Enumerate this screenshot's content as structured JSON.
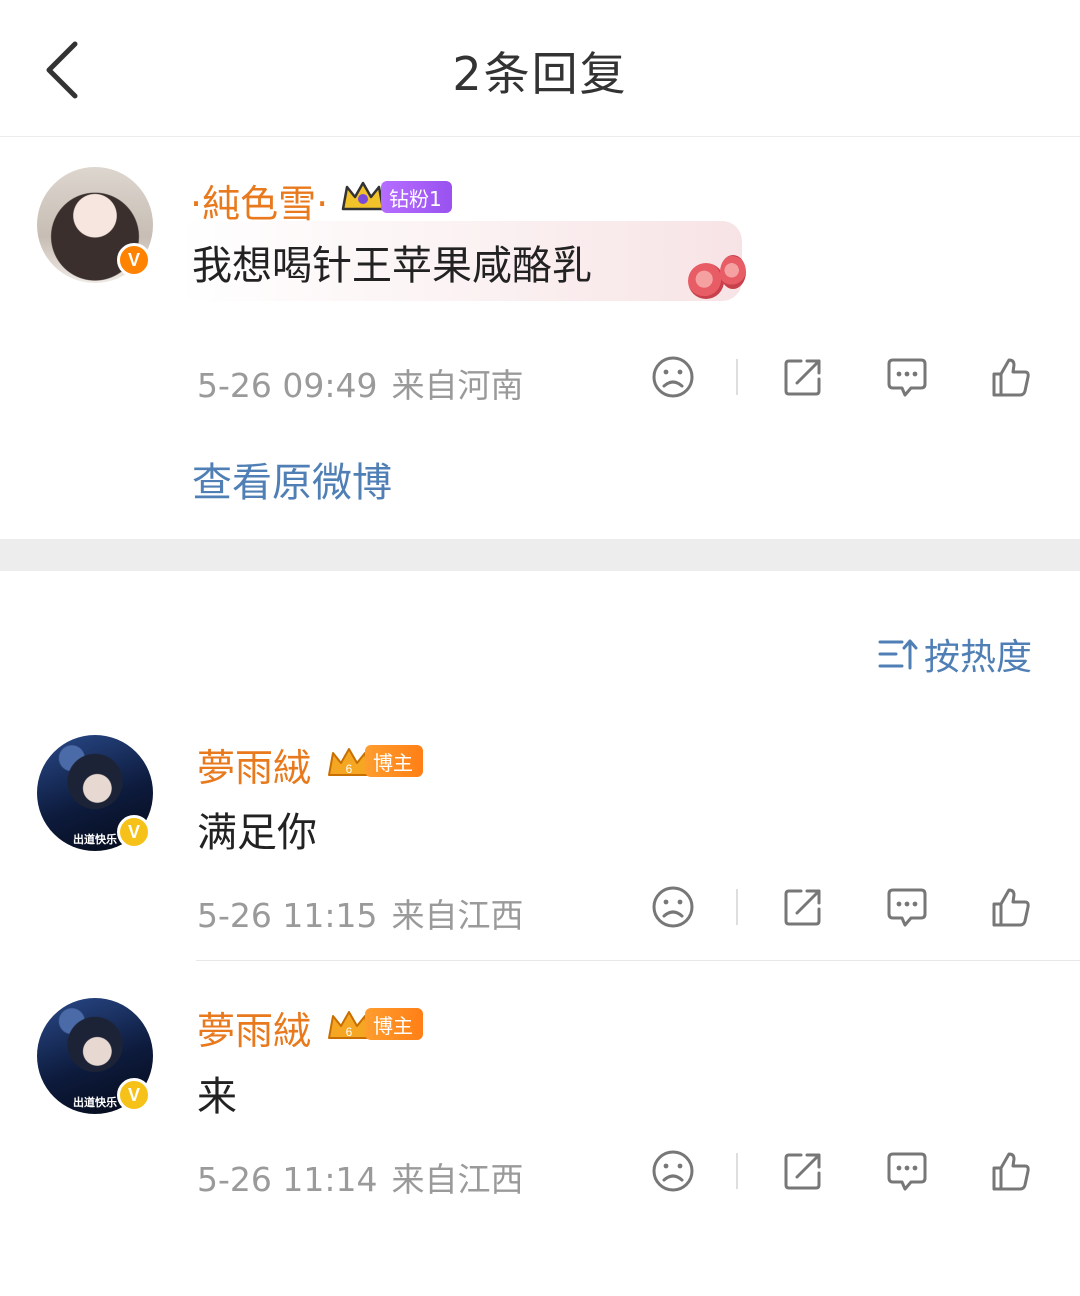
{
  "header": {
    "title": "2条回复",
    "back_icon": "chevron-left-icon"
  },
  "root_comment": {
    "username": "·純色雪·",
    "crown_icon": "crown-icon",
    "fan_badge": "钻粉1",
    "text": "我想喝针王苹果咸酪乳",
    "time": "5-26 09:49",
    "location": "来自河南",
    "view_original": "查看原微博"
  },
  "sort": {
    "label": "按热度",
    "icon": "sort-icon"
  },
  "replies": [
    {
      "username": "夢雨絨",
      "badge": "博主",
      "text": "满足你",
      "time": "5-26 11:15",
      "location": "来自江西"
    },
    {
      "username": "夢雨絨",
      "badge": "博主",
      "text": "来",
      "time": "5-26 11:14",
      "location": "来自江西"
    }
  ],
  "colors": {
    "username": "#e8791d",
    "link": "#4f7fb5",
    "meta": "#9a9a9a",
    "fan_badge_purple": "#a45ef6",
    "blogger_badge_orange": "#ff8a1e"
  }
}
